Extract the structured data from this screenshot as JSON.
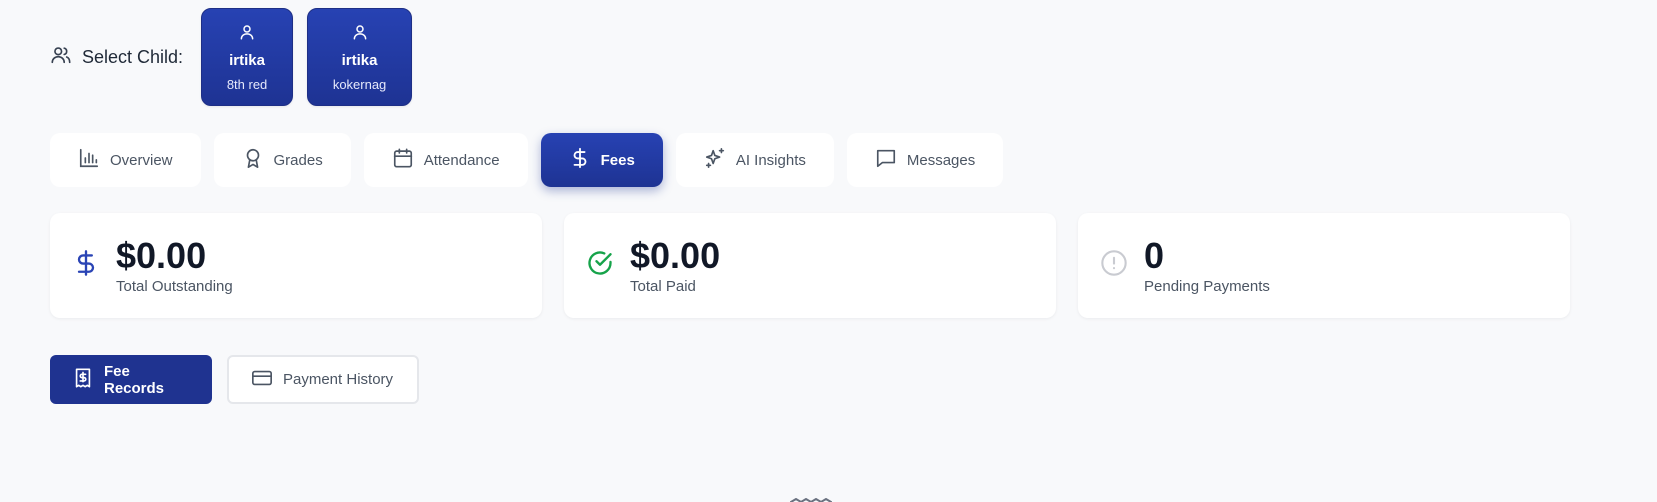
{
  "child_selector": {
    "label": "Select Child:",
    "children": [
      {
        "name": "irtika",
        "class_name": "8th red"
      },
      {
        "name": "irtika",
        "class_name": "kokernag"
      }
    ]
  },
  "tabs": [
    {
      "label": "Overview",
      "icon": "bar-chart-icon"
    },
    {
      "label": "Grades",
      "icon": "award-icon"
    },
    {
      "label": "Attendance",
      "icon": "calendar-icon"
    },
    {
      "label": "Fees",
      "icon": "dollar-icon",
      "active": true
    },
    {
      "label": "AI Insights",
      "icon": "sparkles-icon"
    },
    {
      "label": "Messages",
      "icon": "message-icon"
    }
  ],
  "summary": {
    "outstanding": {
      "value": "$0.00",
      "label": "Total Outstanding",
      "color": "#2a44b5"
    },
    "paid": {
      "value": "$0.00",
      "label": "Total Paid",
      "color": "#16a34a"
    },
    "pending": {
      "value": "0",
      "label": "Pending Payments",
      "color": "#c9cbd1"
    }
  },
  "subtabs": {
    "fee_records": "Fee Records",
    "payment_history": "Payment History"
  },
  "colors": {
    "primary": "#1f3390",
    "background": "#f8f9fb",
    "card": "#ffffff"
  }
}
